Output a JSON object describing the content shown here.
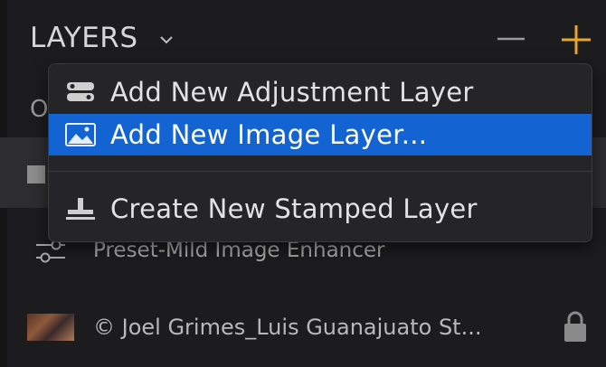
{
  "header": {
    "title": "LAYERS",
    "chevron_icon": "chevron-down-icon",
    "minus_icon": "minus-icon",
    "plus_icon": "plus-icon",
    "accent_color": "#e8a52a"
  },
  "background_rows": {
    "top_label": "O",
    "preset_label": "Preset-Mild Image Enhancer",
    "preset_icon": "sliders-icon",
    "photo_label": "© Joel Grimes_Luis Guanajuato St...",
    "lock_icon": "lock-icon"
  },
  "menu": {
    "items": [
      {
        "label": "Add New Adjustment Layer",
        "icon": "adjustment-layer-icon",
        "highlighted": false
      },
      {
        "label": "Add New Image Layer...",
        "icon": "image-layer-icon",
        "highlighted": true
      },
      {
        "label": "Create New Stamped Layer",
        "icon": "stamp-icon",
        "highlighted": false
      }
    ],
    "highlight_color": "#1463d2"
  }
}
